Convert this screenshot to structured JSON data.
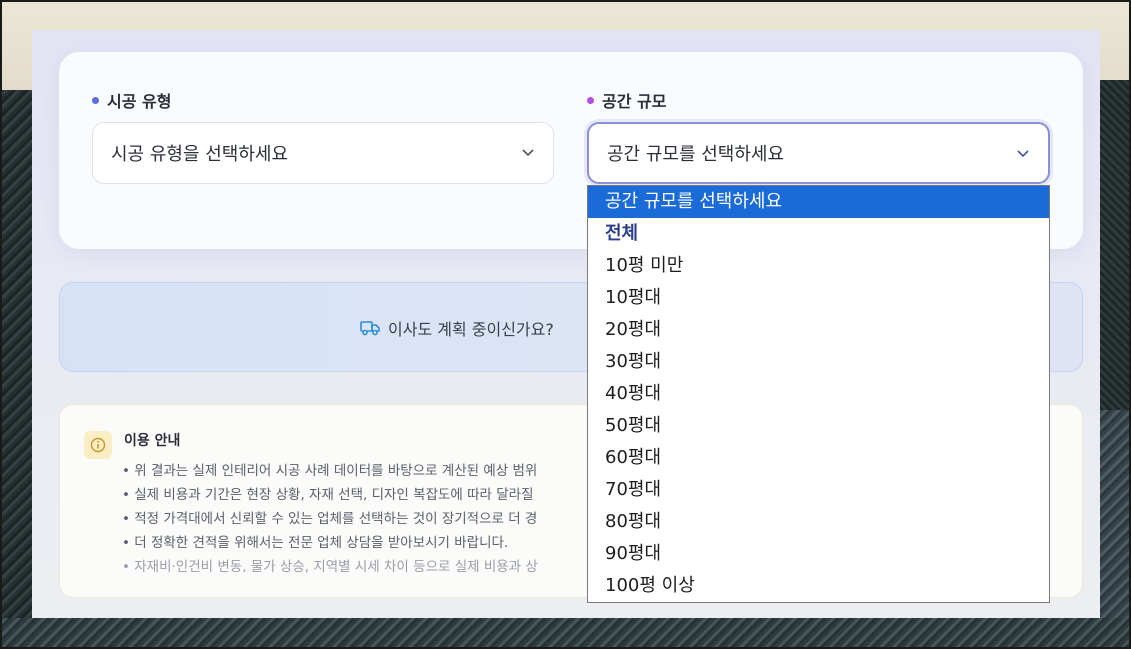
{
  "form": {
    "construction_type": {
      "label": "시공 유형",
      "dot_color": "#5b6ee1",
      "placeholder": "시공 유형을 선택하세요"
    },
    "space_size": {
      "label": "공간 규모",
      "dot_color": "#b44de0",
      "placeholder": "공간 규모를 선택하세요",
      "options": [
        "공간 규모를 선택하세요",
        "전체",
        "10평 미만",
        "10평대",
        "20평대",
        "30평대",
        "40평대",
        "50평대",
        "60평대",
        "70평대",
        "80평대",
        "90평대",
        "100평 이상"
      ],
      "selected_index": 0,
      "group_index": 1
    }
  },
  "banner": {
    "icon": "truck-icon",
    "text": "이사도 계획 중이신가요?",
    "icon_color": "#2d8fd6"
  },
  "notice": {
    "icon": "info-icon",
    "title": "이용 안내",
    "lines": [
      "• 위 결과는 실제 인테리어 시공 사례 데이터를 바탕으로 계산된 예상 범위",
      "• 실제 비용과 기간은 현장 상황, 자재 선택, 디자인 복잡도에 따라 달라질",
      "• 적정 가격대에서 신뢰할 수 있는 업체를 선택하는 것이 장기적으로 더 경",
      "• 더 정확한 견적을 위해서는 전문 업체 상담을 받아보시기 바랍니다.",
      "• 자재비·인건비 변동, 물가 상승, 지역별 시세 차이 등으로 실제 비용과 상"
    ]
  },
  "colors": {
    "selected_option_bg": "#1a6ad8",
    "active_border": "#8a8fd8"
  }
}
